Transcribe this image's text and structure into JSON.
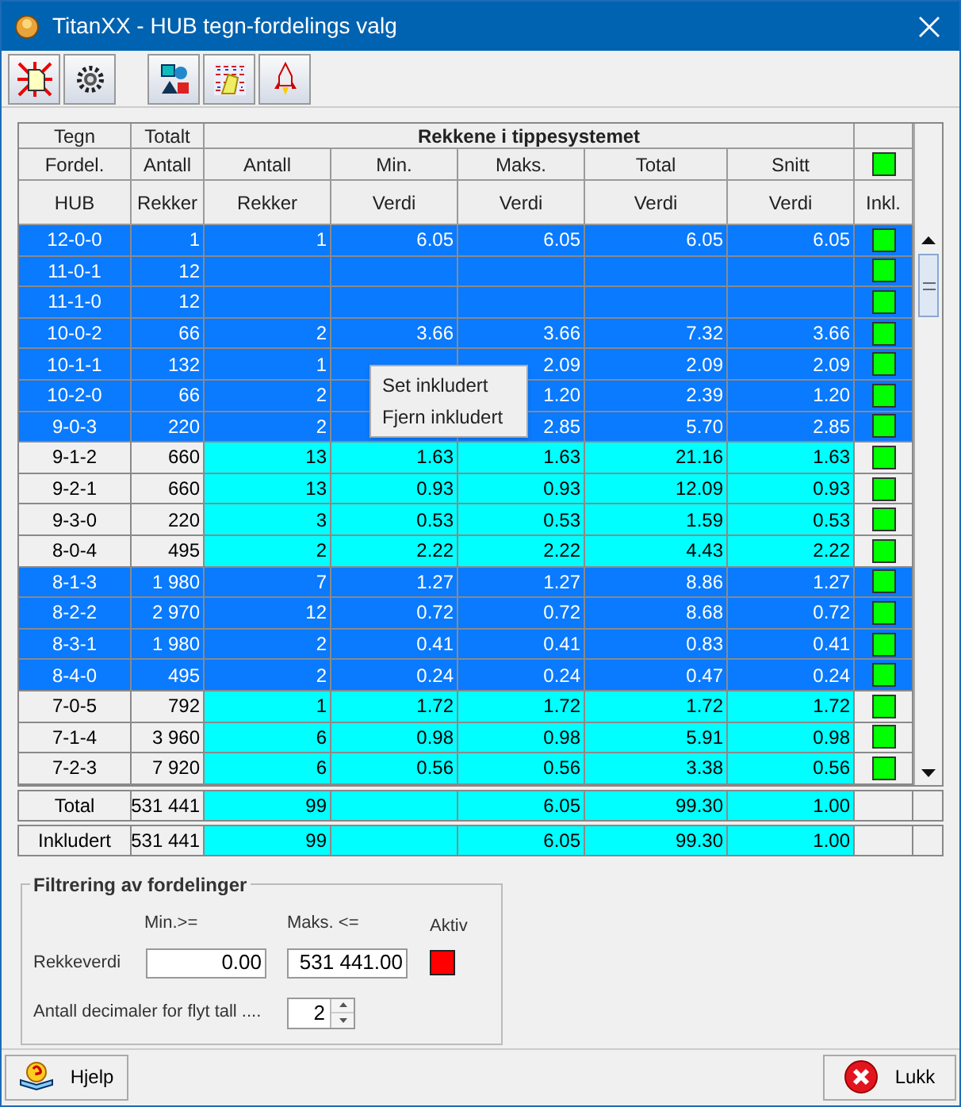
{
  "window": {
    "title": "TitanXX - HUB tegn-fordelings valg"
  },
  "toolbar": [
    {
      "kind": "burst"
    },
    {
      "kind": "gear"
    },
    {
      "kind": "shapes"
    },
    {
      "kind": "paint"
    },
    {
      "kind": "rocket"
    }
  ],
  "table": {
    "group_header": "Rekkene i tippesystemet",
    "header_included": true,
    "columns": [
      {
        "top": "Tegn",
        "mid": "Fordel.",
        "bottom": "HUB"
      },
      {
        "top": "Totalt",
        "mid": "Antall",
        "bottom": "Rekker"
      },
      {
        "mid": "Antall",
        "bottom": "Rekker"
      },
      {
        "mid": "Min.",
        "bottom": "Verdi"
      },
      {
        "mid": "Maks.",
        "bottom": "Verdi"
      },
      {
        "mid": "Total",
        "bottom": "Verdi"
      },
      {
        "mid": "Snitt",
        "bottom": "Verdi"
      },
      {
        "bottom": "Inkl."
      }
    ],
    "rows": [
      {
        "selected": true,
        "included": true,
        "hub": "12-0-0",
        "rekker": "1",
        "antall": "1",
        "min": "6.05",
        "maks": "6.05",
        "total": "6.05",
        "snitt": "6.05"
      },
      {
        "selected": true,
        "included": true,
        "hub": "11-0-1",
        "rekker": "12"
      },
      {
        "selected": true,
        "included": true,
        "hub": "11-1-0",
        "rekker": "12"
      },
      {
        "selected": true,
        "included": true,
        "hub": "10-0-2",
        "rekker": "66",
        "antall": "2",
        "min": "3.66",
        "maks": "3.66",
        "total": "7.32",
        "snitt": "3.66"
      },
      {
        "selected": true,
        "included": true,
        "hub": "10-1-1",
        "rekker": "132",
        "antall": "1",
        "maks": "2.09",
        "total": "2.09",
        "snitt": "2.09"
      },
      {
        "selected": true,
        "included": true,
        "hub": "10-2-0",
        "rekker": "66",
        "antall": "2",
        "maks": "1.20",
        "total": "2.39",
        "snitt": "1.20"
      },
      {
        "selected": true,
        "included": true,
        "hub": "9-0-3",
        "rekker": "220",
        "antall": "2",
        "maks": "2.85",
        "total": "5.70",
        "snitt": "2.85"
      },
      {
        "selected": false,
        "included": true,
        "hub": "9-1-2",
        "rekker": "660",
        "antall": "13",
        "min": "1.63",
        "maks": "1.63",
        "total": "21.16",
        "snitt": "1.63"
      },
      {
        "selected": false,
        "included": true,
        "hub": "9-2-1",
        "rekker": "660",
        "antall": "13",
        "min": "0.93",
        "maks": "0.93",
        "total": "12.09",
        "snitt": "0.93"
      },
      {
        "selected": false,
        "included": true,
        "hub": "9-3-0",
        "rekker": "220",
        "antall": "3",
        "min": "0.53",
        "maks": "0.53",
        "total": "1.59",
        "snitt": "0.53"
      },
      {
        "selected": false,
        "included": true,
        "hub": "8-0-4",
        "rekker": "495",
        "antall": "2",
        "min": "2.22",
        "maks": "2.22",
        "total": "4.43",
        "snitt": "2.22"
      },
      {
        "selected": true,
        "included": true,
        "hub": "8-1-3",
        "rekker": "1 980",
        "antall": "7",
        "min": "1.27",
        "maks": "1.27",
        "total": "8.86",
        "snitt": "1.27"
      },
      {
        "selected": true,
        "included": true,
        "hub": "8-2-2",
        "rekker": "2 970",
        "antall": "12",
        "min": "0.72",
        "maks": "0.72",
        "total": "8.68",
        "snitt": "0.72"
      },
      {
        "selected": true,
        "included": true,
        "hub": "8-3-1",
        "rekker": "1 980",
        "antall": "2",
        "min": "0.41",
        "maks": "0.41",
        "total": "0.83",
        "snitt": "0.41"
      },
      {
        "selected": true,
        "included": true,
        "hub": "8-4-0",
        "rekker": "495",
        "antall": "2",
        "min": "0.24",
        "maks": "0.24",
        "total": "0.47",
        "snitt": "0.24"
      },
      {
        "selected": false,
        "included": true,
        "hub": "7-0-5",
        "rekker": "792",
        "antall": "1",
        "min": "1.72",
        "maks": "1.72",
        "total": "1.72",
        "snitt": "1.72"
      },
      {
        "selected": false,
        "included": true,
        "hub": "7-1-4",
        "rekker": "3 960",
        "antall": "6",
        "min": "0.98",
        "maks": "0.98",
        "total": "5.91",
        "snitt": "0.98"
      },
      {
        "selected": false,
        "included": true,
        "hub": "7-2-3",
        "rekker": "7 920",
        "antall": "6",
        "min": "0.56",
        "maks": "0.56",
        "total": "3.38",
        "snitt": "0.56"
      }
    ],
    "totals": [
      {
        "hub": "Total",
        "rekker": "531 441",
        "antall": "99",
        "maks": "6.05",
        "total": "99.30",
        "snitt": "1.00"
      },
      {
        "hub": "Inkludert",
        "rekker": "531 441",
        "antall": "99",
        "maks": "6.05",
        "total": "99.30",
        "snitt": "1.00"
      }
    ]
  },
  "context_menu": {
    "items": [
      "Set inkludert",
      "Fjern inkludert"
    ]
  },
  "filter": {
    "title": "Filtrering av fordelinger",
    "min_label": "Min.>=",
    "max_label": "Maks. <=",
    "active_label": "Aktiv",
    "row_label": "Rekkeverdi",
    "min_value": "0.00",
    "max_value": "531 441.00",
    "active": false,
    "decimals_label": "Antall decimaler for flyt tall ....",
    "decimals": "2"
  },
  "buttons": [
    {
      "kind": "help",
      "label": "Hjelp"
    },
    {
      "kind": "close",
      "label": "Lukk"
    }
  ]
}
